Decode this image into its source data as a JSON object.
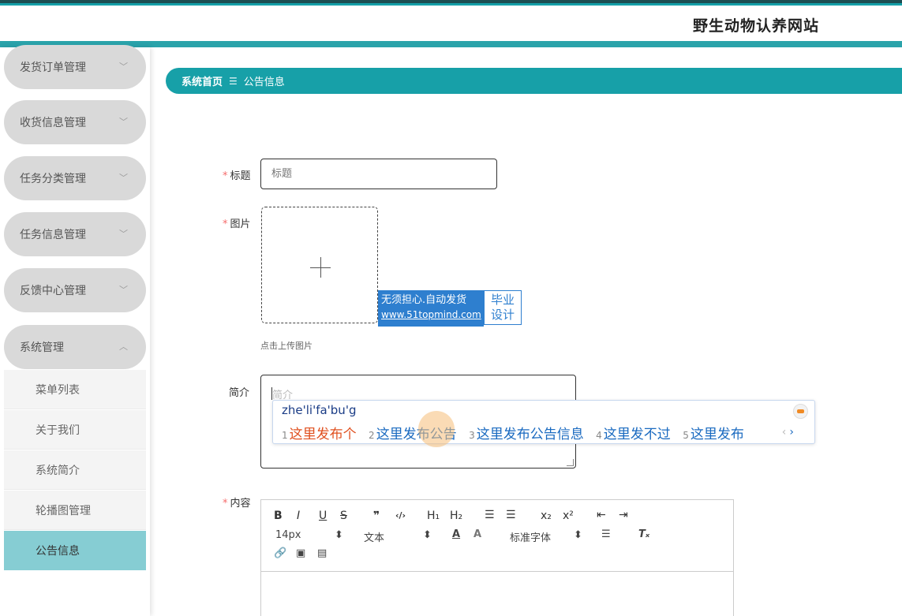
{
  "header": {
    "site_title": "野生动物认养网站"
  },
  "sidebar": {
    "menus": [
      {
        "label": "发货订单管理",
        "chevron": "chevron-down-icon"
      },
      {
        "label": "收货信息管理",
        "chevron": "chevron-down-icon"
      },
      {
        "label": "任务分类管理",
        "chevron": "chevron-down-icon"
      },
      {
        "label": "任务信息管理",
        "chevron": "chevron-down-icon"
      },
      {
        "label": "反馈中心管理",
        "chevron": "chevron-down-icon"
      },
      {
        "label": "系统管理",
        "chevron": "chevron-up-icon"
      }
    ],
    "sub_items": [
      {
        "label": "菜单列表"
      },
      {
        "label": "关于我们"
      },
      {
        "label": "系统简介"
      },
      {
        "label": "轮播图管理"
      },
      {
        "label": "公告信息",
        "active": true
      }
    ]
  },
  "breadcrumb": {
    "home": "系统首页",
    "separator": "☰",
    "current": "公告信息"
  },
  "form": {
    "title_label": "标题",
    "title_placeholder": "标题",
    "image_label": "图片",
    "upload_hint": "点击上传图片",
    "intro_label": "简介",
    "intro_placeholder": "简介",
    "content_label": "内容",
    "required_mark": "*"
  },
  "watermark": {
    "line1": "无须担心.自动发货",
    "url": "www.51topmind.com",
    "right_line1": "毕业",
    "right_line2": "设计"
  },
  "ime": {
    "pinyin": "zhe'li'fa'bu'g",
    "candidates": [
      {
        "num": "1",
        "word": "这里发布个"
      },
      {
        "num": "2",
        "word": "这里发布公告"
      },
      {
        "num": "3",
        "word": "这里发布公告信息"
      },
      {
        "num": "4",
        "word": "这里发不过"
      },
      {
        "num": "5",
        "word": "这里发布"
      }
    ],
    "prev": "‹",
    "next": "›"
  },
  "editor": {
    "font_size": "14px",
    "header_select": "文本",
    "font_family": "标准字体"
  },
  "colors": {
    "accent": "#17a0a8",
    "sidebar_active": "#86cdd3",
    "required": "#f56c6c"
  }
}
